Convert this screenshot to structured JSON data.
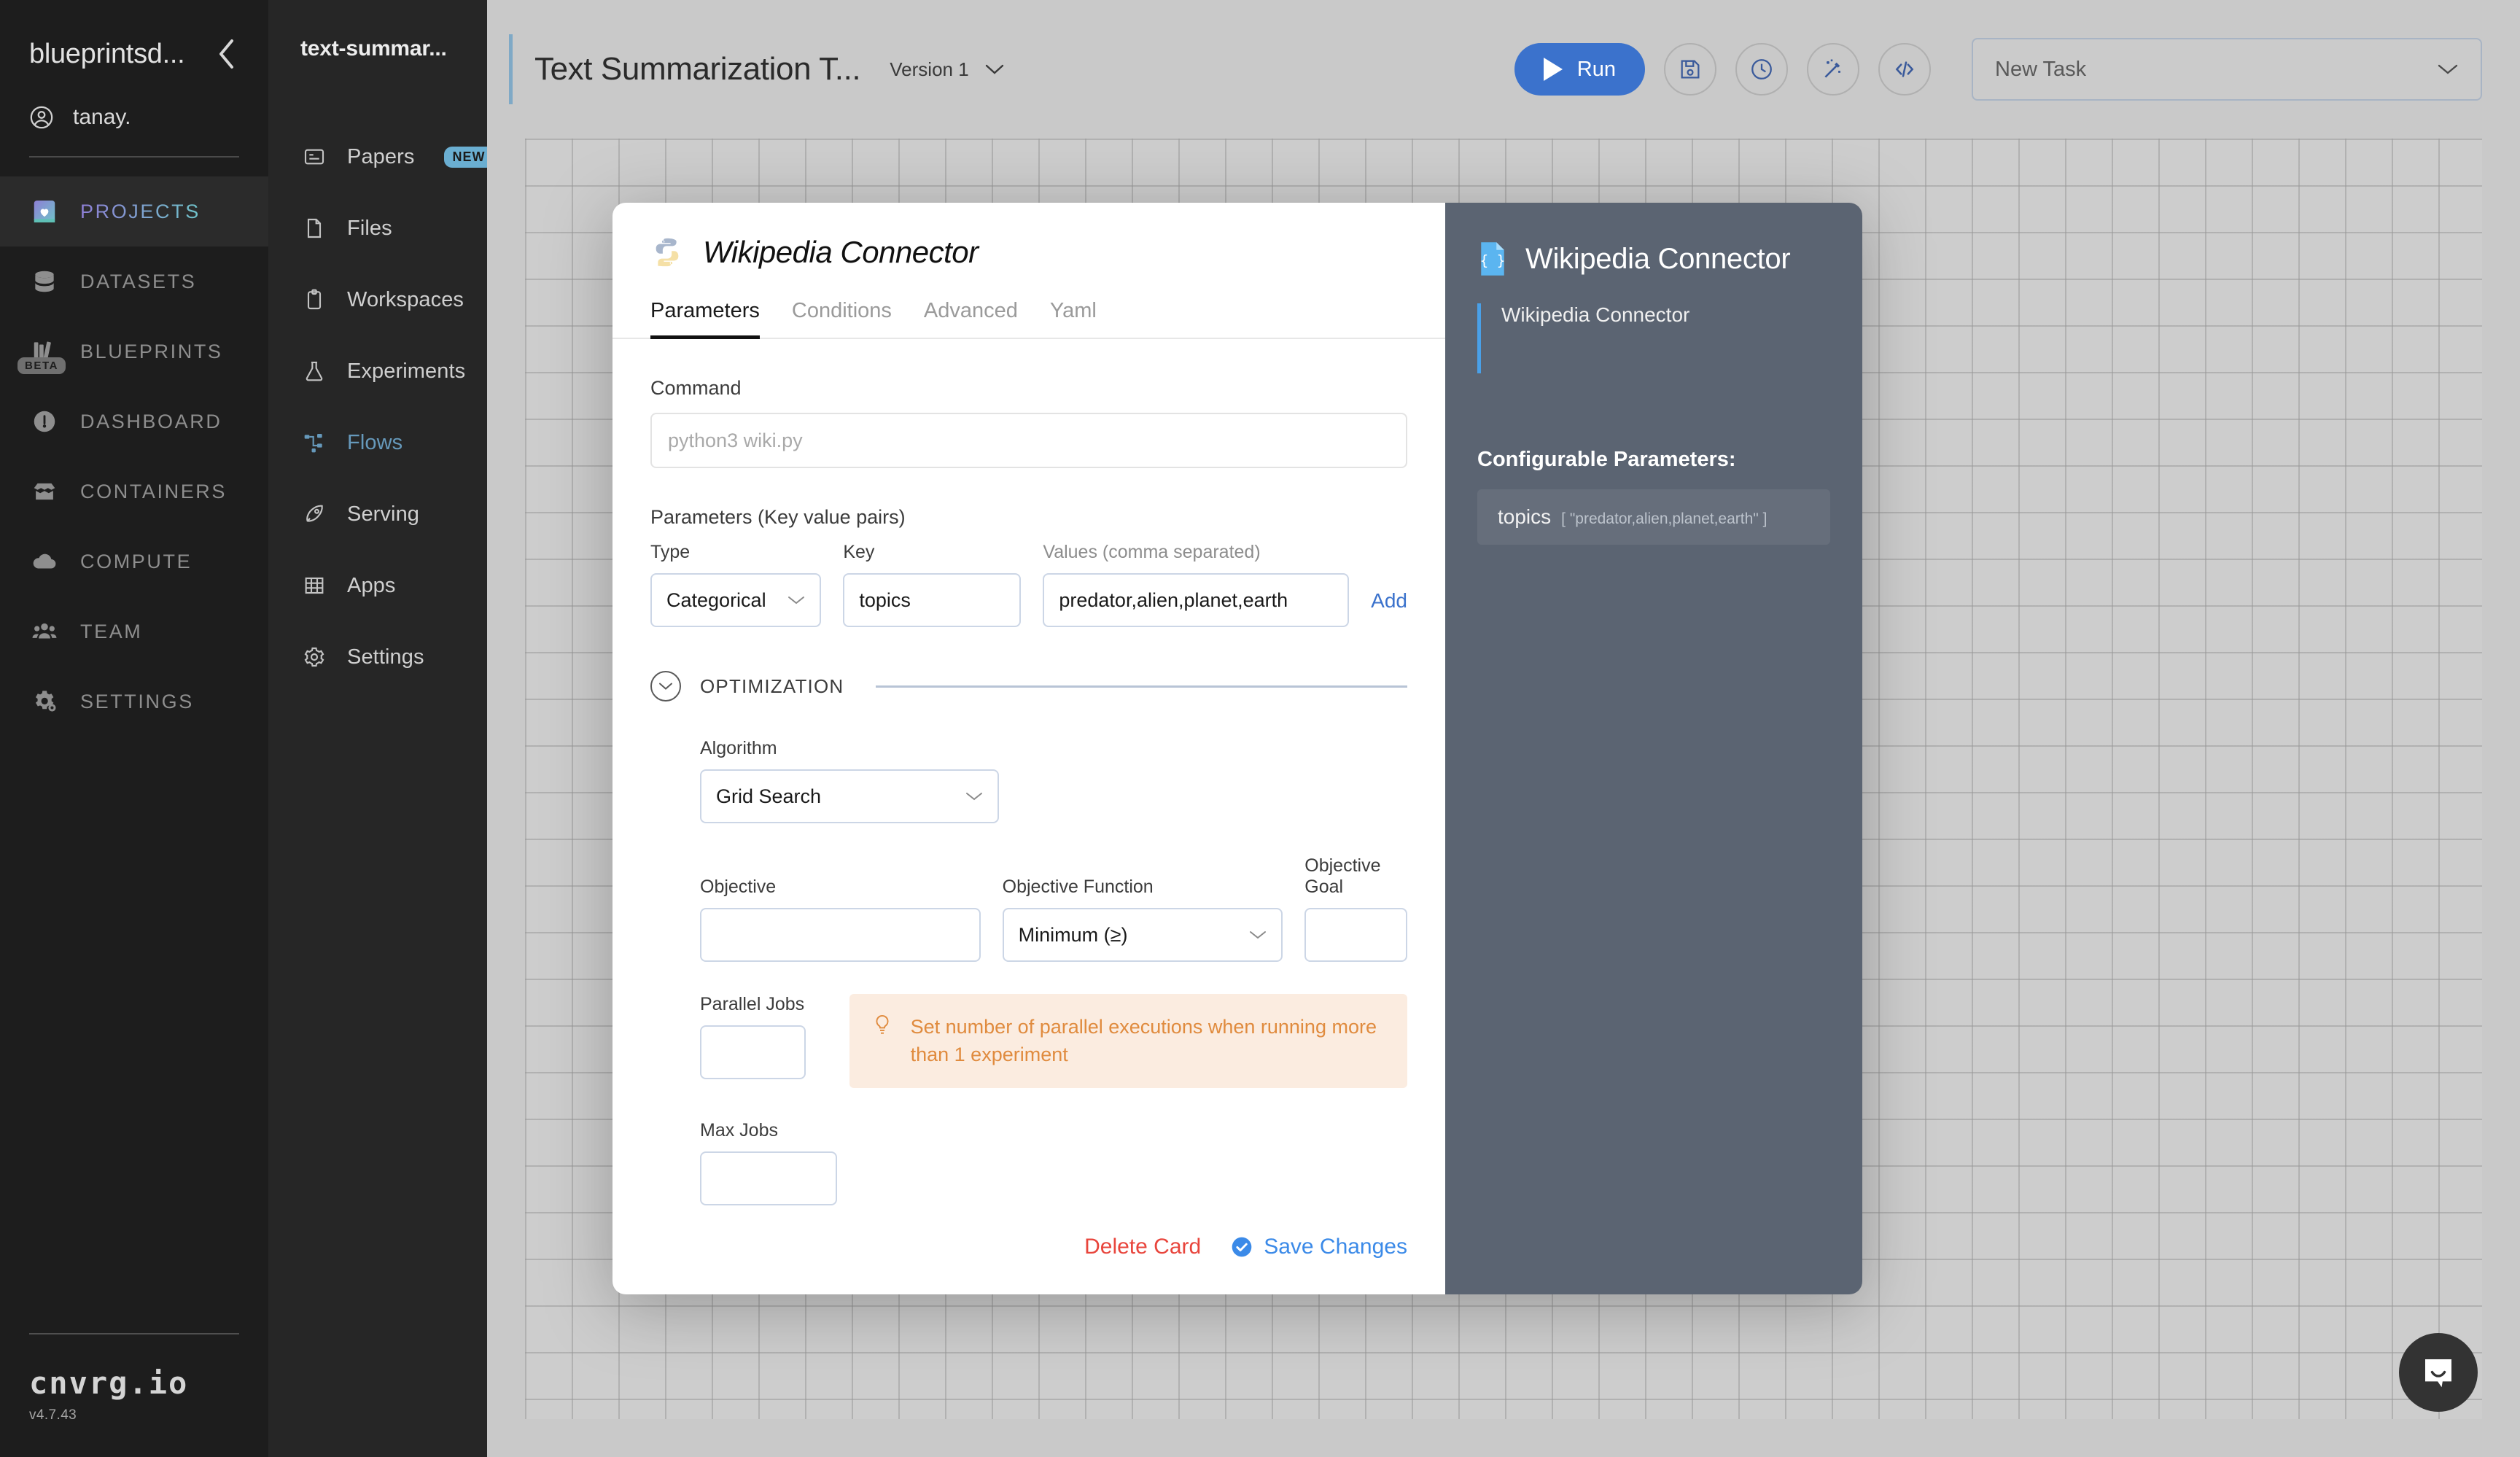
{
  "sidebar_primary": {
    "org_name": "blueprintsd...",
    "collapse_icon": "chevron-left-icon",
    "user": {
      "name": "tanay.",
      "icon": "user-circle-icon"
    },
    "items": [
      {
        "label": "PROJECTS",
        "icon": "book-heart-icon",
        "active": true
      },
      {
        "label": "DATASETS",
        "icon": "database-icon",
        "active": false
      },
      {
        "label": "BLUEPRINTS",
        "icon": "books-icon",
        "active": false,
        "badge": "BETA"
      },
      {
        "label": "DASHBOARD",
        "icon": "gauge-icon",
        "active": false
      },
      {
        "label": "CONTAINERS",
        "icon": "box-open-icon",
        "active": false
      },
      {
        "label": "COMPUTE",
        "icon": "cloud-icon",
        "active": false
      },
      {
        "label": "TEAM",
        "icon": "people-icon",
        "active": false
      },
      {
        "label": "SETTINGS",
        "icon": "gears-icon",
        "active": false
      }
    ],
    "brand": {
      "name": "cnvrg.io",
      "version": "v4.7.43"
    }
  },
  "sidebar_secondary": {
    "project_name": "text-summar...",
    "items": [
      {
        "label": "Papers",
        "icon": "article-icon",
        "badge": "NEW",
        "active": false
      },
      {
        "label": "Files",
        "icon": "file-icon",
        "active": false
      },
      {
        "label": "Workspaces",
        "icon": "clipboard-icon",
        "active": false
      },
      {
        "label": "Experiments",
        "icon": "flask-icon",
        "active": false
      },
      {
        "label": "Flows",
        "icon": "flow-nodes-icon",
        "active": true
      },
      {
        "label": "Serving",
        "icon": "rocket-icon",
        "active": false
      },
      {
        "label": "Apps",
        "icon": "grid-icon",
        "active": false
      },
      {
        "label": "Settings",
        "icon": "gear-icon",
        "active": false
      }
    ]
  },
  "topbar": {
    "flow_title": "Text Summarization T...",
    "version_label": "Version 1",
    "version_caret_icon": "chevron-down-icon",
    "run_label": "Run",
    "run_icon": "play-icon",
    "actions": [
      {
        "name": "save-flow-button",
        "icon": "floppy-disk-icon"
      },
      {
        "name": "history-button",
        "icon": "clock-icon"
      },
      {
        "name": "magic-button",
        "icon": "magic-wand-icon"
      },
      {
        "name": "code-button",
        "icon": "code-brackets-icon"
      }
    ],
    "task_select": {
      "value": "New Task",
      "caret_icon": "chevron-down-icon"
    },
    "accent_color": "#3b72cc"
  },
  "card": {
    "title": "Wikipedia Connector",
    "title_icon": "python-icon",
    "tabs": [
      {
        "label": "Parameters",
        "active": true
      },
      {
        "label": "Conditions",
        "active": false
      },
      {
        "label": "Advanced",
        "active": false
      },
      {
        "label": "Yaml",
        "active": false
      }
    ],
    "command": {
      "label": "Command",
      "value": "",
      "placeholder": "python3 wiki.py"
    },
    "parameters": {
      "section_label": "Parameters (Key value pairs)",
      "col_type": "Type",
      "col_key": "Key",
      "col_values": "Values (comma separated)",
      "add_label": "Add",
      "rows": [
        {
          "type": "Categorical",
          "key": "topics",
          "values": "predator,alien,planet,earth"
        }
      ]
    },
    "optimization": {
      "title": "OPTIMIZATION",
      "collapse_icon": "chevron-down-circle-icon",
      "algorithm_label": "Algorithm",
      "algorithm_value": "Grid Search",
      "objective_label": "Objective",
      "objective_value": "",
      "objective_function_label": "Objective Function",
      "objective_function_value": "Minimum (≥)",
      "objective_goal_label": "Objective Goal",
      "objective_goal_value": "",
      "parallel_jobs_label": "Parallel Jobs",
      "parallel_jobs_value": "",
      "max_jobs_label": "Max Jobs",
      "max_jobs_value": "",
      "hint_icon": "lightbulb-icon",
      "hint_text": "Set number of parallel executions when running more than 1 experiment",
      "hint_color": "#e08b3e"
    },
    "footer": {
      "delete_label": "Delete Card",
      "delete_color": "#e8453c",
      "save_label": "Save Changes",
      "save_icon": "check-circle-icon",
      "save_color": "#3b8ae8"
    }
  },
  "info_panel": {
    "title": "Wikipedia Connector",
    "title_icon": "json-file-icon",
    "description": "Wikipedia Connector",
    "configurable_title": "Configurable Parameters:",
    "parameters": [
      {
        "key": "topics",
        "value": "[ \"predator,alien,planet,earth\" ]"
      }
    ],
    "accent_color": "#49a0e8"
  },
  "chat": {
    "icon": "intercom-chat-icon"
  }
}
